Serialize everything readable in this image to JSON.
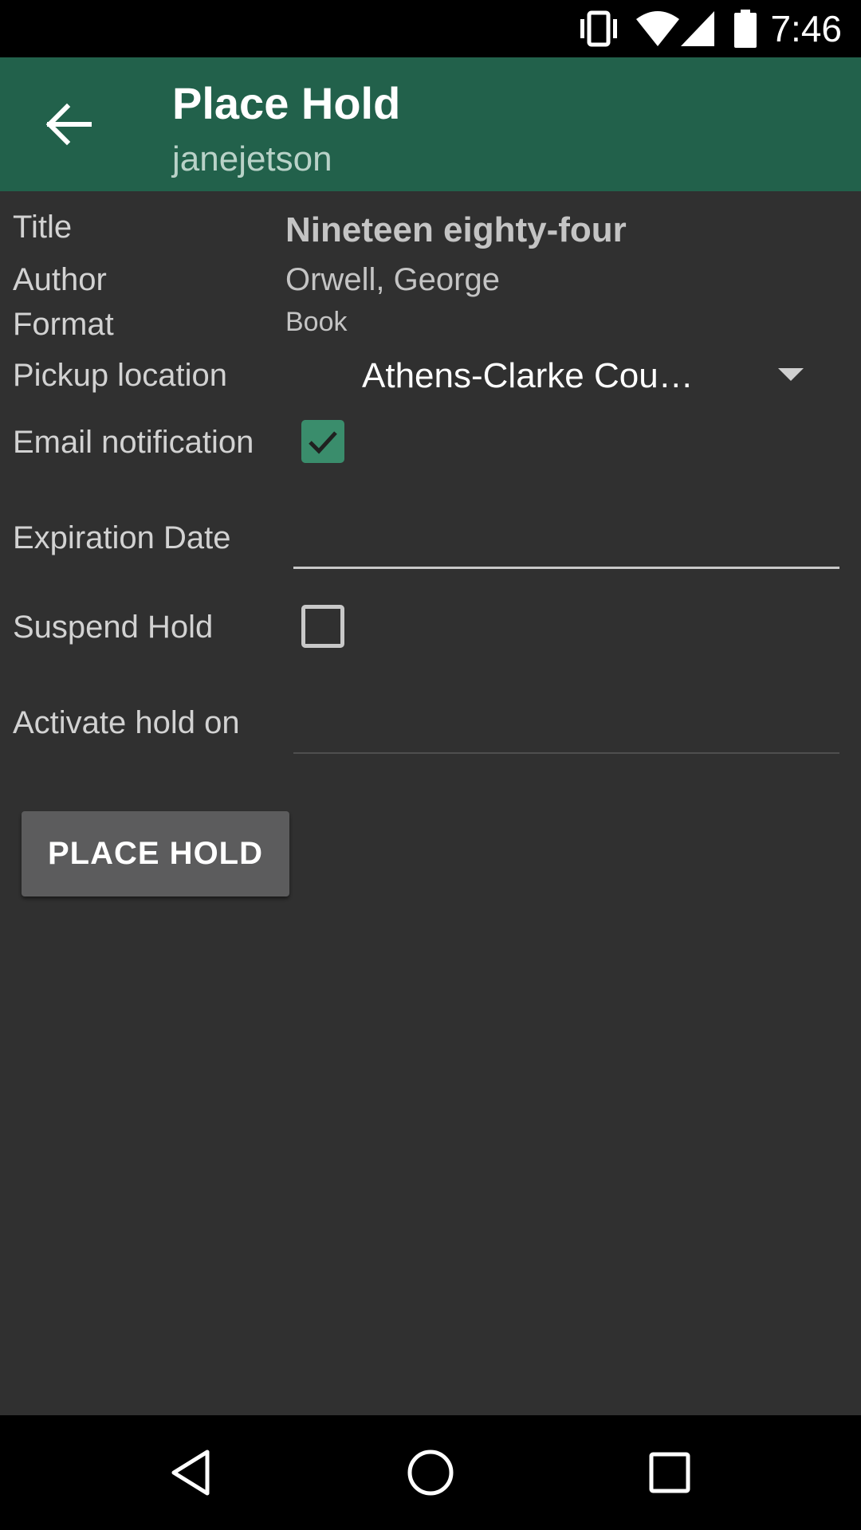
{
  "status_bar": {
    "time": "7:46",
    "icons": [
      "vibrate-icon",
      "wifi-icon",
      "signal-icon",
      "battery-icon"
    ]
  },
  "app_bar": {
    "title": "Place Hold",
    "subtitle": "janejetson",
    "back_icon": "arrow-left-icon",
    "color": "#22614b"
  },
  "form": {
    "title_label": "Title",
    "title_value": "Nineteen eighty-four",
    "author_label": "Author",
    "author_value": "Orwell, George",
    "format_label": "Format",
    "format_value": "Book",
    "pickup_label": "Pickup location",
    "pickup_value": "Athens-Clarke Cou…",
    "email_label": "Email notification",
    "email_checked": true,
    "expiration_label": "Expiration Date",
    "expiration_value": "",
    "suspend_label": "Suspend Hold",
    "suspend_checked": false,
    "activate_label": "Activate hold on",
    "activate_value": ""
  },
  "actions": {
    "place_hold_label": "PLACE HOLD"
  },
  "nav_bar": {
    "icons": [
      "back-triangle-icon",
      "home-circle-icon",
      "recents-square-icon"
    ]
  },
  "colors": {
    "background": "#303030",
    "accent": "#3a8d6c",
    "button": "#5c5c5d"
  }
}
